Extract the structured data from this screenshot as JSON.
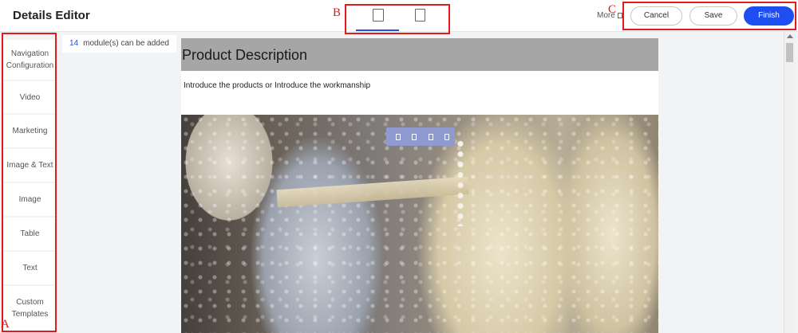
{
  "header": {
    "title": "Details Editor",
    "more_label": "More",
    "cancel_label": "Cancel",
    "save_label": "Save",
    "finish_label": "Finish",
    "device_toggle": [
      {
        "icon": "desktop-icon",
        "active": true
      },
      {
        "icon": "mobile-icon",
        "active": false
      }
    ]
  },
  "annotations": {
    "a": "A",
    "b": "B",
    "c": "C",
    "color": "#e01b1b"
  },
  "sidebar": {
    "items": [
      {
        "label": "Navigation Configuration"
      },
      {
        "label": "Video"
      },
      {
        "label": "Marketing"
      },
      {
        "label": "Image & Text"
      },
      {
        "label": "Image"
      },
      {
        "label": "Table"
      },
      {
        "label": "Text"
      },
      {
        "label": "Custom Templates"
      }
    ]
  },
  "modules": {
    "count": "14",
    "text": "module(s) can be added"
  },
  "canvas": {
    "title": "Product Description",
    "intro": "Introduce the products or Introduce the workmanship",
    "image_toolbar_icons": [
      "move-up-icon",
      "move-down-icon",
      "copy-icon",
      "delete-icon"
    ]
  },
  "colors": {
    "accent": "#1f4ef0",
    "toolbar": "#8f9bd0",
    "title_bar": "#a6a6a6"
  }
}
